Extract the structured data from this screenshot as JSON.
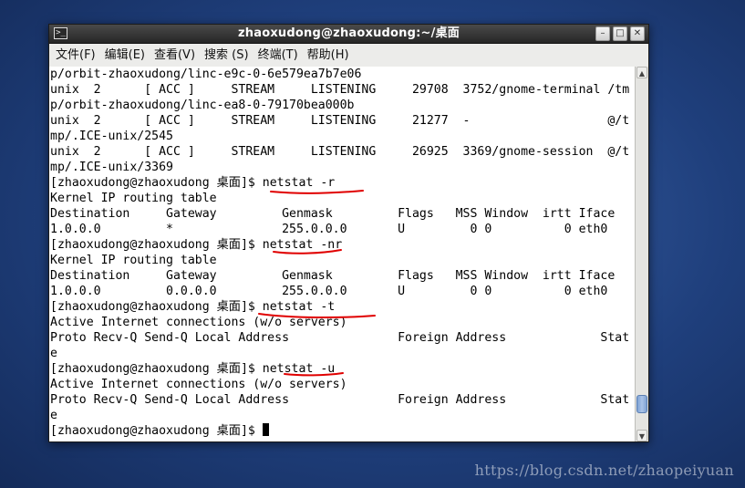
{
  "window": {
    "title": "zhaoxudong@zhaoxudong:~/桌面",
    "app_icon": "terminal-icon",
    "controls": [
      {
        "name": "minimize-button",
        "glyph": "–"
      },
      {
        "name": "maximize-button",
        "glyph": "□"
      },
      {
        "name": "close-button",
        "glyph": "✕"
      }
    ]
  },
  "menu": [
    "文件(F)",
    "编辑(E)",
    "查看(V)",
    "搜索 (S)",
    "终端(T)",
    "帮助(H)"
  ],
  "terminal": {
    "lines": [
      "p/orbit-zhaoxudong/linc-e9c-0-6e579ea7b7e06",
      "unix  2      [ ACC ]     STREAM     LISTENING     29708  3752/gnome-terminal /tm",
      "p/orbit-zhaoxudong/linc-ea8-0-79170bea000b",
      "unix  2      [ ACC ]     STREAM     LISTENING     21277  -                   @/t",
      "mp/.ICE-unix/2545",
      "unix  2      [ ACC ]     STREAM     LISTENING     26925  3369/gnome-session  @/t",
      "mp/.ICE-unix/3369",
      "[zhaoxudong@zhaoxudong 桌面]$ netstat -r",
      "Kernel IP routing table",
      "Destination     Gateway         Genmask         Flags   MSS Window  irtt Iface",
      "1.0.0.0         *               255.0.0.0       U         0 0          0 eth0",
      "[zhaoxudong@zhaoxudong 桌面]$ netstat -nr",
      "Kernel IP routing table",
      "Destination     Gateway         Genmask         Flags   MSS Window  irtt Iface",
      "1.0.0.0         0.0.0.0         255.0.0.0       U         0 0          0 eth0",
      "[zhaoxudong@zhaoxudong 桌面]$ netstat -t",
      "Active Internet connections (w/o servers)",
      "Proto Recv-Q Send-Q Local Address               Foreign Address             Stat",
      "e",
      "[zhaoxudong@zhaoxudong 桌面]$ netstat -u",
      "Active Internet connections (w/o servers)",
      "Proto Recv-Q Send-Q Local Address               Foreign Address             Stat",
      "e"
    ],
    "prompt": "[zhaoxudong@zhaoxudong 桌面]$ "
  },
  "scrollbar": {
    "up_icon": "arrow-up-icon",
    "down_icon": "arrow-down-icon",
    "position_fraction": 0.95,
    "visible_fraction": 0.05
  },
  "annotation_color": "#e00000",
  "watermark": "https://blog.csdn.net/zhaopeiyuan"
}
